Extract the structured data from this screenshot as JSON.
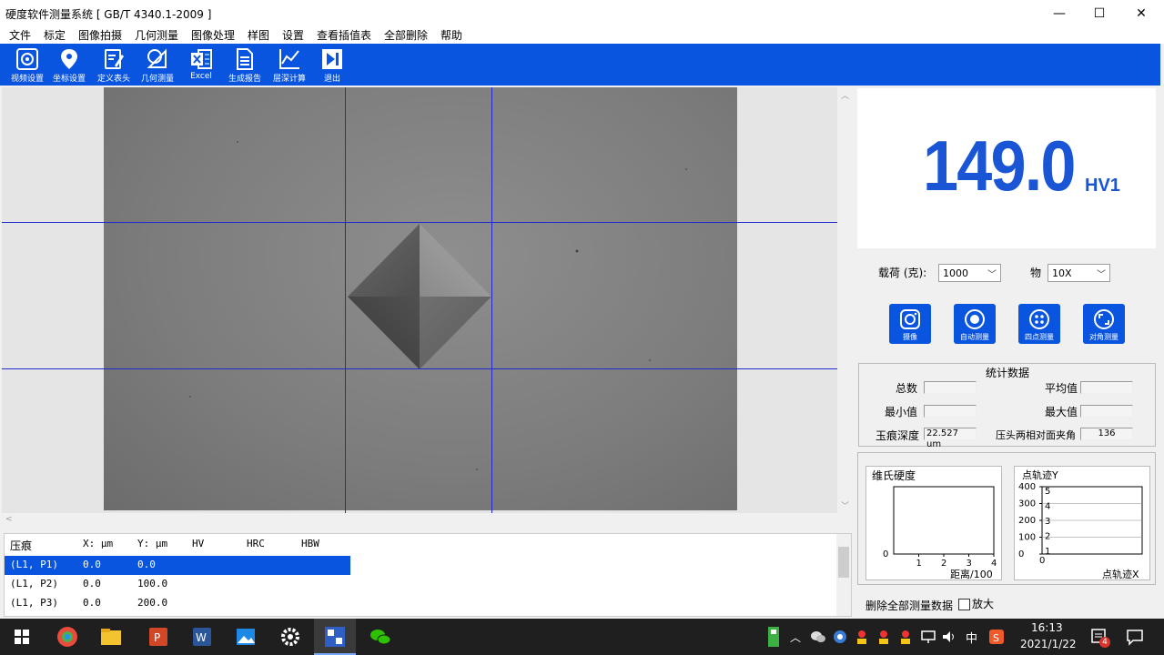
{
  "window": {
    "title": "硬度软件测量系统 [ GB/T 4340.1-2009 ]",
    "minimize": "—",
    "maximize": "☐",
    "close": "✕"
  },
  "menu": [
    "文件",
    "标定",
    "图像拍摄",
    "几何测量",
    "图像处理",
    "样图",
    "设置",
    "查看插值表",
    "全部删除",
    "帮助"
  ],
  "toolbar": [
    {
      "label": "视频设置",
      "icon": "video-settings-icon"
    },
    {
      "label": "坐标设置",
      "icon": "location-pin-icon"
    },
    {
      "label": "定义表头",
      "icon": "edit-document-icon"
    },
    {
      "label": "几何测量",
      "icon": "geometry-measure-icon"
    },
    {
      "label": "Excel",
      "icon": "excel-icon"
    },
    {
      "label": "生成报告",
      "icon": "report-icon"
    },
    {
      "label": "层深计算",
      "icon": "line-chart-icon"
    },
    {
      "label": "退出",
      "icon": "exit-icon"
    }
  ],
  "readout": {
    "value": "149.0",
    "unit": "HV1"
  },
  "load": {
    "label": "载荷 (克):",
    "value": "1000"
  },
  "objective": {
    "label": "物",
    "value": "10X"
  },
  "actions": [
    {
      "label": "摄像",
      "icon": "camera-icon"
    },
    {
      "label": "自动测量",
      "icon": "auto-measure-icon"
    },
    {
      "label": "四点测量",
      "icon": "four-point-icon"
    },
    {
      "label": "对角测量",
      "icon": "diagonal-measure-icon"
    }
  ],
  "stats": {
    "title": "统计数据",
    "total_label": "总数",
    "avg_label": "平均值",
    "min_label": "最小值",
    "max_label": "最大值",
    "depth_label": "玉痕深度",
    "depth_value": "22.527 um",
    "angle_label": "压头两相对面夹角",
    "angle_value": "136"
  },
  "table": {
    "headers": [
      "压痕",
      "X: μm",
      "Y: μm",
      "HV",
      "HRC",
      "HBW"
    ],
    "rows": [
      {
        "id": "(L1, P1)",
        "x": "0.0",
        "y": "0.0"
      },
      {
        "id": "(L1, P2)",
        "x": "0.0",
        "y": "100.0"
      },
      {
        "id": "(L1, P3)",
        "x": "0.0",
        "y": "200.0"
      }
    ]
  },
  "chart_data": [
    {
      "type": "line",
      "title": "维氏硬度",
      "xlabel": "距离/100",
      "ylabel": "",
      "x_ticks": [
        "1",
        "2",
        "3",
        "4"
      ],
      "y_ticks": [
        "0"
      ],
      "series": []
    },
    {
      "type": "line",
      "title": "点轨迹Y",
      "xlabel": "点轨迹X",
      "ylabel": "",
      "y_ticks_left": [
        "0",
        "100",
        "200",
        "300",
        "400"
      ],
      "y_ticks_inner": [
        "1",
        "2",
        "3",
        "4",
        "5"
      ],
      "x_ticks": [
        "0"
      ],
      "series": []
    }
  ],
  "bottom": {
    "delete_all": "删除全部测量数据",
    "magnify": "放大"
  },
  "taskbar": {
    "time": "16:13",
    "date": "2021/1/22",
    "ime": "中",
    "notif_count": "4"
  }
}
